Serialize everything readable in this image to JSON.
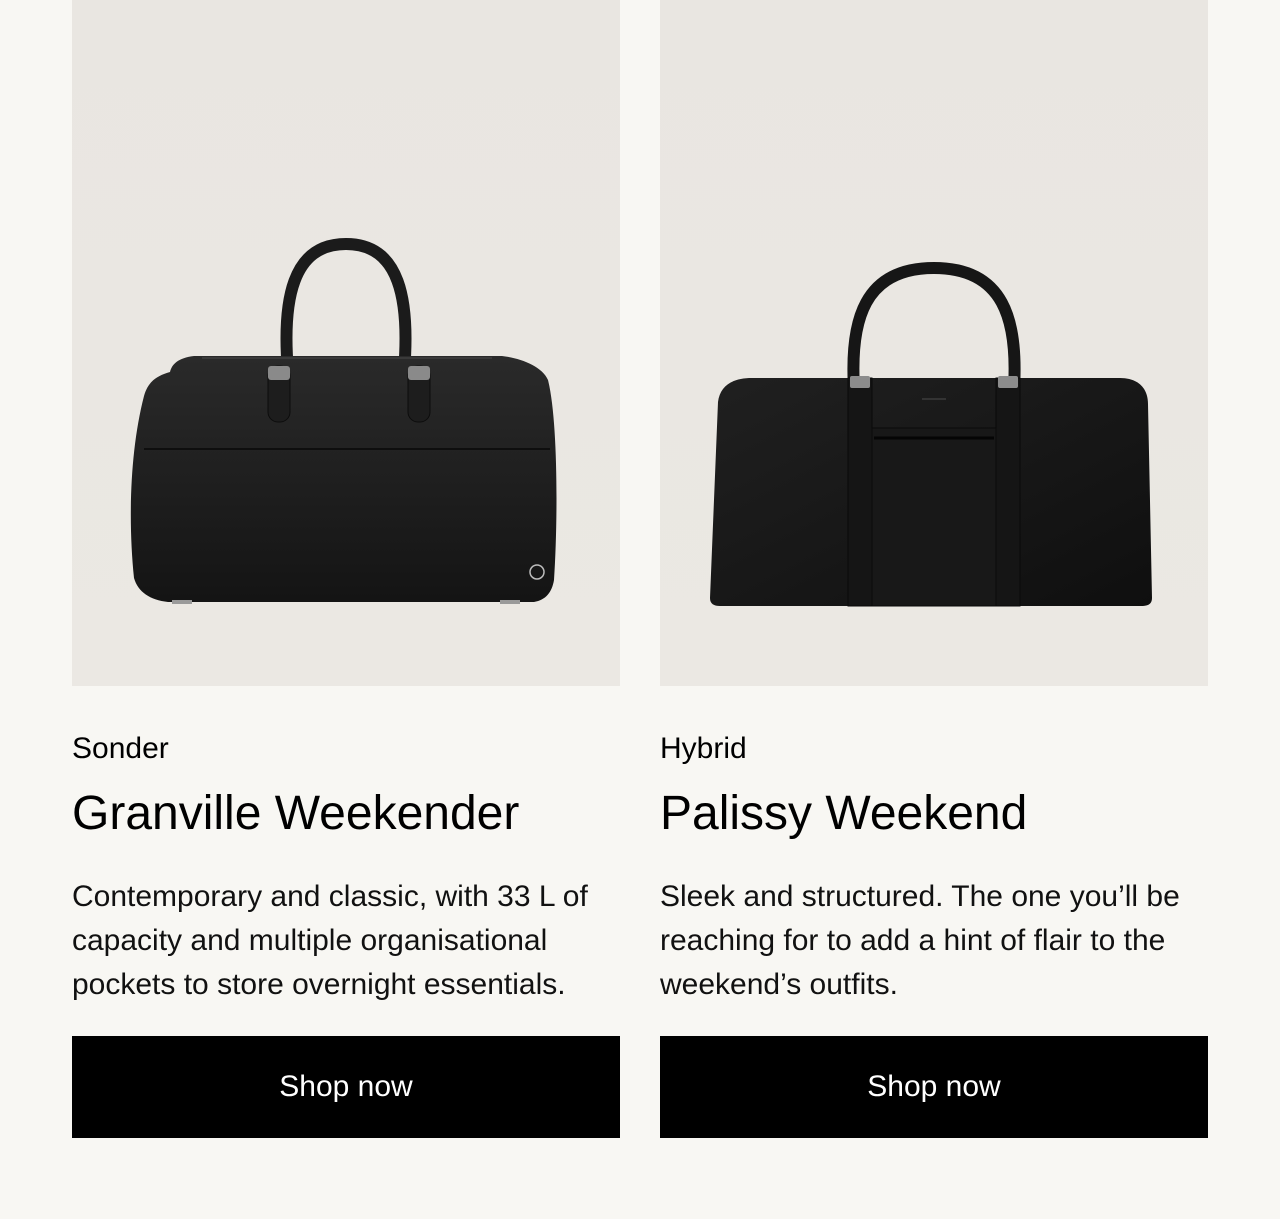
{
  "products": [
    {
      "category": "Sonder",
      "name": "Granville Weekender",
      "description": "Contemporary and classic, with 33 L of capacity and multiple organisational pockets to store overnight essentials.",
      "button_label": "Shop now",
      "image_icon": "bag-photo"
    },
    {
      "category": "Hybrid",
      "name": "Palissy Weekend",
      "description": "Sleek and structured. The one you’ll be reaching for to add a hint of flair to the weekend’s outfits.",
      "button_label": "Shop now",
      "image_icon": "bag-photo"
    }
  ],
  "colors": {
    "page_background": "#f8f7f3",
    "image_background": "#ebe8e3",
    "button_background": "#000000",
    "button_text": "#ffffff"
  }
}
